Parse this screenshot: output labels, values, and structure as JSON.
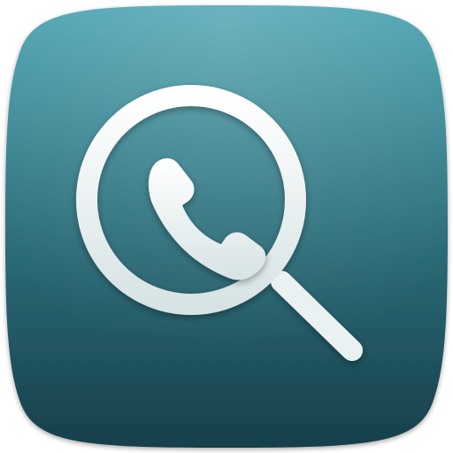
{
  "app_icon": {
    "name": "call-lookup-app-icon",
    "glyphs": [
      "magnifying-glass-icon",
      "phone-handset-icon"
    ],
    "colors": {
      "tile_top": "#4aa3b1",
      "tile_bottom": "#173f4a",
      "glyph_fill": "#e9f1f1",
      "glyph_shadow": "#0d2a33"
    }
  }
}
